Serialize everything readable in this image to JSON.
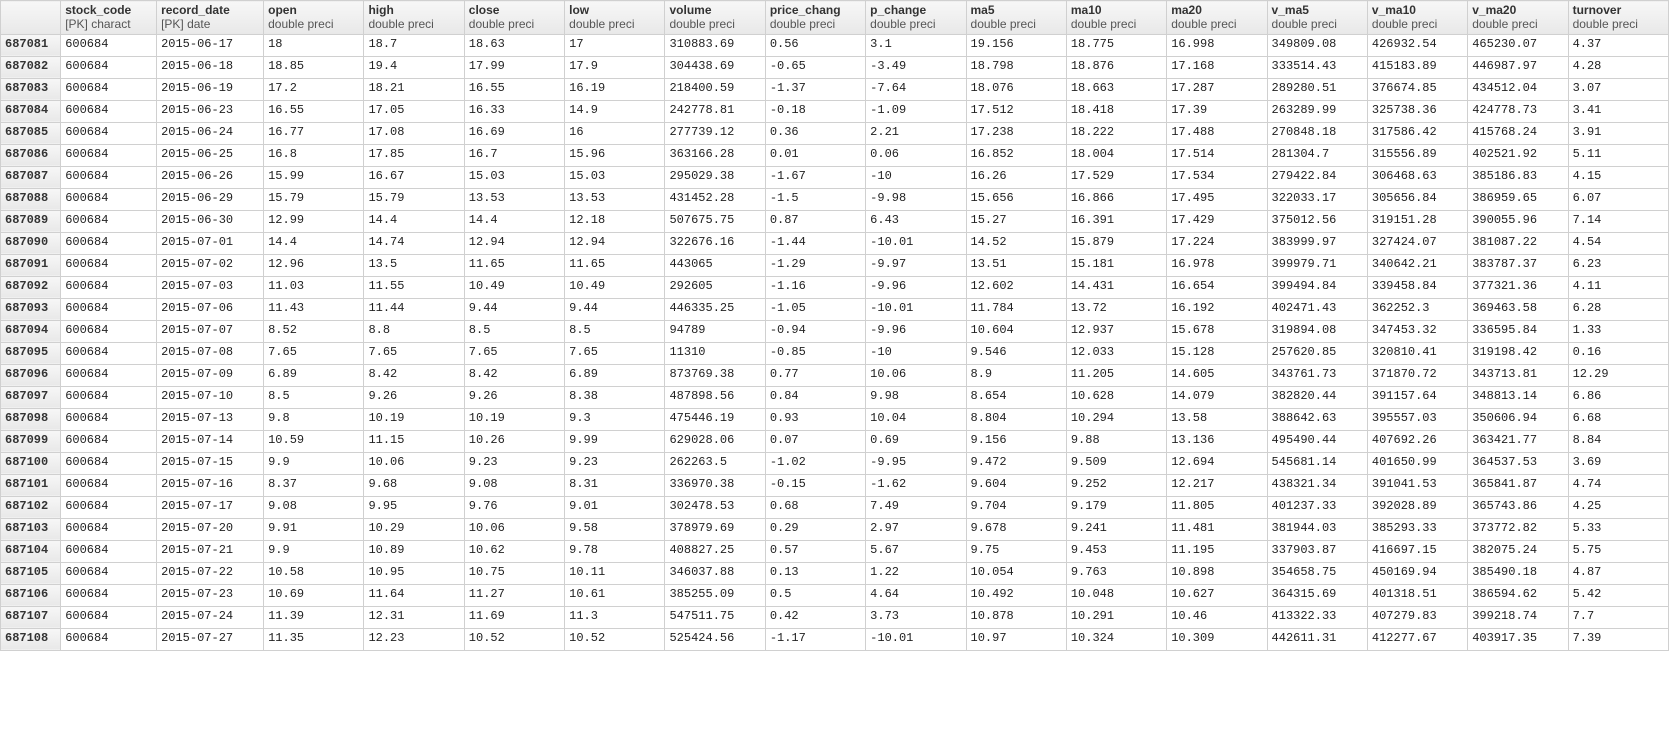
{
  "columns": [
    {
      "name": "stock_code",
      "type": "[PK] charact"
    },
    {
      "name": "record_date",
      "type": "[PK] date"
    },
    {
      "name": "open",
      "type": "double preci"
    },
    {
      "name": "high",
      "type": "double preci"
    },
    {
      "name": "close",
      "type": "double preci"
    },
    {
      "name": "low",
      "type": "double preci"
    },
    {
      "name": "volume",
      "type": "double preci"
    },
    {
      "name": "price_chang",
      "type": "double preci"
    },
    {
      "name": "p_change",
      "type": "double preci"
    },
    {
      "name": "ma5",
      "type": "double preci"
    },
    {
      "name": "ma10",
      "type": "double preci"
    },
    {
      "name": "ma20",
      "type": "double preci"
    },
    {
      "name": "v_ma5",
      "type": "double preci"
    },
    {
      "name": "v_ma10",
      "type": "double preci"
    },
    {
      "name": "v_ma20",
      "type": "double preci"
    },
    {
      "name": "turnover",
      "type": "double preci"
    }
  ],
  "rows": [
    {
      "rownum": "687081",
      "cells": [
        "600684",
        "2015-06-17",
        "18",
        "18.7",
        "18.63",
        "17",
        "310883.69",
        "0.56",
        "3.1",
        "19.156",
        "18.775",
        "16.998",
        "349809.08",
        "426932.54",
        "465230.07",
        "4.37"
      ]
    },
    {
      "rownum": "687082",
      "cells": [
        "600684",
        "2015-06-18",
        "18.85",
        "19.4",
        "17.99",
        "17.9",
        "304438.69",
        "-0.65",
        "-3.49",
        "18.798",
        "18.876",
        "17.168",
        "333514.43",
        "415183.89",
        "446987.97",
        "4.28"
      ]
    },
    {
      "rownum": "687083",
      "cells": [
        "600684",
        "2015-06-19",
        "17.2",
        "18.21",
        "16.55",
        "16.19",
        "218400.59",
        "-1.37",
        "-7.64",
        "18.076",
        "18.663",
        "17.287",
        "289280.51",
        "376674.85",
        "434512.04",
        "3.07"
      ]
    },
    {
      "rownum": "687084",
      "cells": [
        "600684",
        "2015-06-23",
        "16.55",
        "17.05",
        "16.33",
        "14.9",
        "242778.81",
        "-0.18",
        "-1.09",
        "17.512",
        "18.418",
        "17.39",
        "263289.99",
        "325738.36",
        "424778.73",
        "3.41"
      ]
    },
    {
      "rownum": "687085",
      "cells": [
        "600684",
        "2015-06-24",
        "16.77",
        "17.08",
        "16.69",
        "16",
        "277739.12",
        "0.36",
        "2.21",
        "17.238",
        "18.222",
        "17.488",
        "270848.18",
        "317586.42",
        "415768.24",
        "3.91"
      ]
    },
    {
      "rownum": "687086",
      "cells": [
        "600684",
        "2015-06-25",
        "16.8",
        "17.85",
        "16.7",
        "15.96",
        "363166.28",
        "0.01",
        "0.06",
        "16.852",
        "18.004",
        "17.514",
        "281304.7",
        "315556.89",
        "402521.92",
        "5.11"
      ]
    },
    {
      "rownum": "687087",
      "cells": [
        "600684",
        "2015-06-26",
        "15.99",
        "16.67",
        "15.03",
        "15.03",
        "295029.38",
        "-1.67",
        "-10",
        "16.26",
        "17.529",
        "17.534",
        "279422.84",
        "306468.63",
        "385186.83",
        "4.15"
      ]
    },
    {
      "rownum": "687088",
      "cells": [
        "600684",
        "2015-06-29",
        "15.79",
        "15.79",
        "13.53",
        "13.53",
        "431452.28",
        "-1.5",
        "-9.98",
        "15.656",
        "16.866",
        "17.495",
        "322033.17",
        "305656.84",
        "386959.65",
        "6.07"
      ]
    },
    {
      "rownum": "687089",
      "cells": [
        "600684",
        "2015-06-30",
        "12.99",
        "14.4",
        "14.4",
        "12.18",
        "507675.75",
        "0.87",
        "6.43",
        "15.27",
        "16.391",
        "17.429",
        "375012.56",
        "319151.28",
        "390055.96",
        "7.14"
      ]
    },
    {
      "rownum": "687090",
      "cells": [
        "600684",
        "2015-07-01",
        "14.4",
        "14.74",
        "12.94",
        "12.94",
        "322676.16",
        "-1.44",
        "-10.01",
        "14.52",
        "15.879",
        "17.224",
        "383999.97",
        "327424.07",
        "381087.22",
        "4.54"
      ]
    },
    {
      "rownum": "687091",
      "cells": [
        "600684",
        "2015-07-02",
        "12.96",
        "13.5",
        "11.65",
        "11.65",
        "443065",
        "-1.29",
        "-9.97",
        "13.51",
        "15.181",
        "16.978",
        "399979.71",
        "340642.21",
        "383787.37",
        "6.23"
      ]
    },
    {
      "rownum": "687092",
      "cells": [
        "600684",
        "2015-07-03",
        "11.03",
        "11.55",
        "10.49",
        "10.49",
        "292605",
        "-1.16",
        "-9.96",
        "12.602",
        "14.431",
        "16.654",
        "399494.84",
        "339458.84",
        "377321.36",
        "4.11"
      ]
    },
    {
      "rownum": "687093",
      "cells": [
        "600684",
        "2015-07-06",
        "11.43",
        "11.44",
        "9.44",
        "9.44",
        "446335.25",
        "-1.05",
        "-10.01",
        "11.784",
        "13.72",
        "16.192",
        "402471.43",
        "362252.3",
        "369463.58",
        "6.28"
      ]
    },
    {
      "rownum": "687094",
      "cells": [
        "600684",
        "2015-07-07",
        "8.52",
        "8.8",
        "8.5",
        "8.5",
        "94789",
        "-0.94",
        "-9.96",
        "10.604",
        "12.937",
        "15.678",
        "319894.08",
        "347453.32",
        "336595.84",
        "1.33"
      ]
    },
    {
      "rownum": "687095",
      "cells": [
        "600684",
        "2015-07-08",
        "7.65",
        "7.65",
        "7.65",
        "7.65",
        "11310",
        "-0.85",
        "-10",
        "9.546",
        "12.033",
        "15.128",
        "257620.85",
        "320810.41",
        "319198.42",
        "0.16"
      ]
    },
    {
      "rownum": "687096",
      "cells": [
        "600684",
        "2015-07-09",
        "6.89",
        "8.42",
        "8.42",
        "6.89",
        "873769.38",
        "0.77",
        "10.06",
        "8.9",
        "11.205",
        "14.605",
        "343761.73",
        "371870.72",
        "343713.81",
        "12.29"
      ]
    },
    {
      "rownum": "687097",
      "cells": [
        "600684",
        "2015-07-10",
        "8.5",
        "9.26",
        "9.26",
        "8.38",
        "487898.56",
        "0.84",
        "9.98",
        "8.654",
        "10.628",
        "14.079",
        "382820.44",
        "391157.64",
        "348813.14",
        "6.86"
      ]
    },
    {
      "rownum": "687098",
      "cells": [
        "600684",
        "2015-07-13",
        "9.8",
        "10.19",
        "10.19",
        "9.3",
        "475446.19",
        "0.93",
        "10.04",
        "8.804",
        "10.294",
        "13.58",
        "388642.63",
        "395557.03",
        "350606.94",
        "6.68"
      ]
    },
    {
      "rownum": "687099",
      "cells": [
        "600684",
        "2015-07-14",
        "10.59",
        "11.15",
        "10.26",
        "9.99",
        "629028.06",
        "0.07",
        "0.69",
        "9.156",
        "9.88",
        "13.136",
        "495490.44",
        "407692.26",
        "363421.77",
        "8.84"
      ]
    },
    {
      "rownum": "687100",
      "cells": [
        "600684",
        "2015-07-15",
        "9.9",
        "10.06",
        "9.23",
        "9.23",
        "262263.5",
        "-1.02",
        "-9.95",
        "9.472",
        "9.509",
        "12.694",
        "545681.14",
        "401650.99",
        "364537.53",
        "3.69"
      ]
    },
    {
      "rownum": "687101",
      "cells": [
        "600684",
        "2015-07-16",
        "8.37",
        "9.68",
        "9.08",
        "8.31",
        "336970.38",
        "-0.15",
        "-1.62",
        "9.604",
        "9.252",
        "12.217",
        "438321.34",
        "391041.53",
        "365841.87",
        "4.74"
      ]
    },
    {
      "rownum": "687102",
      "cells": [
        "600684",
        "2015-07-17",
        "9.08",
        "9.95",
        "9.76",
        "9.01",
        "302478.53",
        "0.68",
        "7.49",
        "9.704",
        "9.179",
        "11.805",
        "401237.33",
        "392028.89",
        "365743.86",
        "4.25"
      ]
    },
    {
      "rownum": "687103",
      "cells": [
        "600684",
        "2015-07-20",
        "9.91",
        "10.29",
        "10.06",
        "9.58",
        "378979.69",
        "0.29",
        "2.97",
        "9.678",
        "9.241",
        "11.481",
        "381944.03",
        "385293.33",
        "373772.82",
        "5.33"
      ]
    },
    {
      "rownum": "687104",
      "cells": [
        "600684",
        "2015-07-21",
        "9.9",
        "10.89",
        "10.62",
        "9.78",
        "408827.25",
        "0.57",
        "5.67",
        "9.75",
        "9.453",
        "11.195",
        "337903.87",
        "416697.15",
        "382075.24",
        "5.75"
      ]
    },
    {
      "rownum": "687105",
      "cells": [
        "600684",
        "2015-07-22",
        "10.58",
        "10.95",
        "10.75",
        "10.11",
        "346037.88",
        "0.13",
        "1.22",
        "10.054",
        "9.763",
        "10.898",
        "354658.75",
        "450169.94",
        "385490.18",
        "4.87"
      ]
    },
    {
      "rownum": "687106",
      "cells": [
        "600684",
        "2015-07-23",
        "10.69",
        "11.64",
        "11.27",
        "10.61",
        "385255.09",
        "0.5",
        "4.64",
        "10.492",
        "10.048",
        "10.627",
        "364315.69",
        "401318.51",
        "386594.62",
        "5.42"
      ]
    },
    {
      "rownum": "687107",
      "cells": [
        "600684",
        "2015-07-24",
        "11.39",
        "12.31",
        "11.69",
        "11.3",
        "547511.75",
        "0.42",
        "3.73",
        "10.878",
        "10.291",
        "10.46",
        "413322.33",
        "407279.83",
        "399218.74",
        "7.7"
      ]
    },
    {
      "rownum": "687108",
      "cells": [
        "600684",
        "2015-07-27",
        "11.35",
        "12.23",
        "10.52",
        "10.52",
        "525424.56",
        "-1.17",
        "-10.01",
        "10.97",
        "10.324",
        "10.309",
        "442611.31",
        "412277.67",
        "403917.35",
        "7.39"
      ]
    }
  ]
}
